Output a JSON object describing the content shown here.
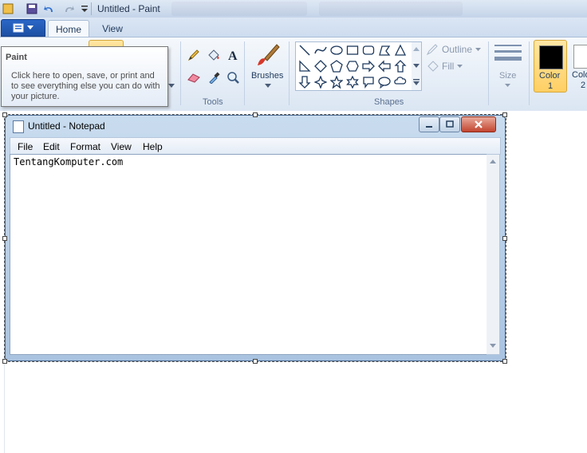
{
  "window": {
    "title": "Untitled - Paint"
  },
  "tabs": {
    "home": "Home",
    "view": "View"
  },
  "tooltip": {
    "title": "Paint",
    "body": "Click here to open, save, or print and to see everything else you can do with your picture."
  },
  "ribbon": {
    "tools_label": "Tools",
    "brushes_label": "Brushes",
    "shapes_label": "Shapes",
    "outline_label": "Outline",
    "fill_label": "Fill",
    "size_label": "Size",
    "color1_label": "Color\n1",
    "color1_line1": "Color",
    "color1_line2": "1",
    "color2_line1": "Colo",
    "color2_line2": "2",
    "color1_value": "#000000",
    "color2_value": "#ffffff"
  },
  "notepad": {
    "title": "Untitled - Notepad",
    "menu": {
      "file": "File",
      "edit": "Edit",
      "format": "Format",
      "view": "View",
      "help": "Help"
    },
    "content": "TentangKomputer.com"
  }
}
